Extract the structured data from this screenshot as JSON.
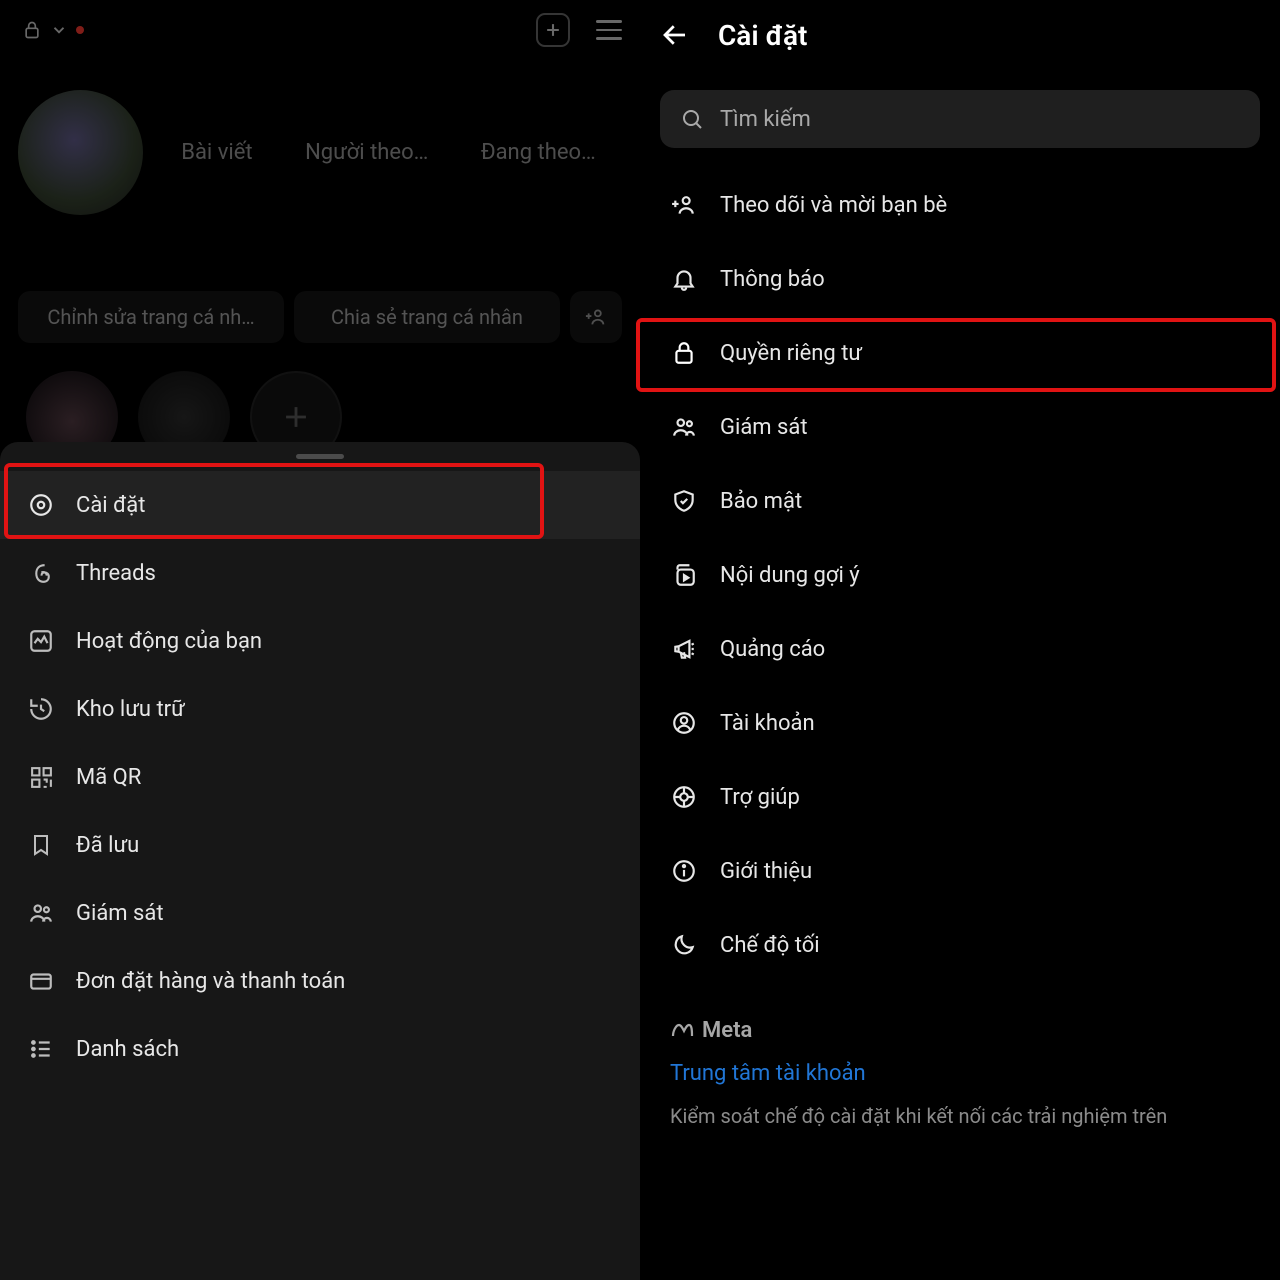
{
  "left": {
    "stats": {
      "posts": "Bài viết",
      "followers": "Người theo…",
      "following": "Đang theo…"
    },
    "buttons": {
      "edit": "Chỉnh sửa trang cá nh…",
      "share": "Chia sẻ trang cá nhân"
    },
    "sheet": {
      "settings": "Cài đặt",
      "threads": "Threads",
      "activity": "Hoạt động của bạn",
      "archive": "Kho lưu trữ",
      "qr": "Mã QR",
      "saved": "Đã lưu",
      "supervision": "Giám sát",
      "orders": "Đơn đặt hàng và thanh toán",
      "list": "Danh sách"
    }
  },
  "right": {
    "title": "Cài đặt",
    "search_placeholder": "Tìm kiếm",
    "rows": {
      "follow": "Theo dõi và mời bạn bè",
      "notifications": "Thông báo",
      "privacy": "Quyền riêng tư",
      "supervision": "Giám sát",
      "security": "Bảo mật",
      "suggested": "Nội dung gợi ý",
      "ads": "Quảng cáo",
      "account": "Tài khoản",
      "help": "Trợ giúp",
      "about": "Giới thiệu",
      "dark": "Chế độ tối"
    },
    "meta_label": "Meta",
    "acct_center": "Trung tâm tài khoản",
    "desc": "Kiểm soát chế độ cài đặt khi kết nối các trải nghiệm trên"
  }
}
